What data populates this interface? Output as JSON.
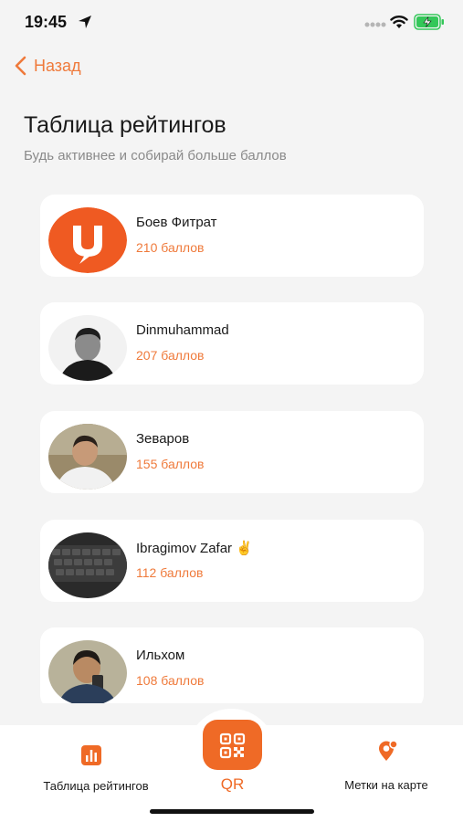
{
  "status_bar": {
    "time": "19:45"
  },
  "nav": {
    "back_label": "Назад"
  },
  "header": {
    "title": "Таблица рейтингов",
    "subtitle": "Будь активнее и собирай больше баллов"
  },
  "leaderboard": [
    {
      "name": "Боев Фитрат",
      "points": "210 баллов"
    },
    {
      "name": "Dinmuhammad",
      "points": "207 баллов"
    },
    {
      "name": "Зеваров",
      "points": "155 баллов"
    },
    {
      "name": "Ibragimov Zafar ✌️",
      "points": "112 баллов"
    },
    {
      "name": "Ильхом",
      "points": "108 баллов"
    }
  ],
  "tab_bar": {
    "rating_label": "Таблица рейтингов",
    "qr_label": "QR",
    "map_label": "Метки на карте"
  },
  "colors": {
    "accent": "#ef7a3b",
    "qr_accent": "#ef6a26",
    "background": "#f4f4f4",
    "card": "#ffffff"
  }
}
